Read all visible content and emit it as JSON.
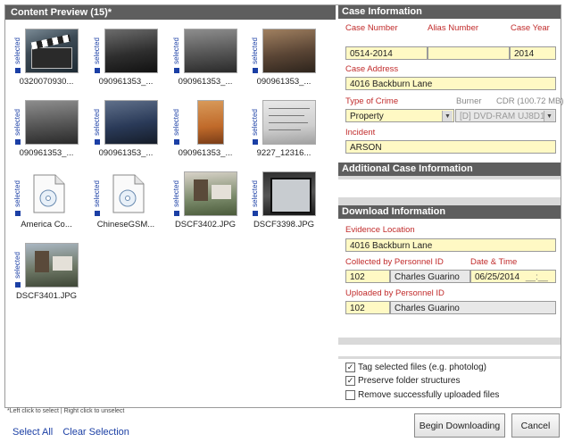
{
  "content_preview": {
    "title": "Content Preview (15)*",
    "selected_label": "selected",
    "items": [
      {
        "caption": "0320070930...",
        "kind": "photo",
        "tone": "clapper"
      },
      {
        "caption": "090961353_...",
        "kind": "photo",
        "tone": "car-dark"
      },
      {
        "caption": "090961353_...",
        "kind": "photo",
        "tone": "car-gray"
      },
      {
        "caption": "090961353_...",
        "kind": "photo",
        "tone": "car-brown"
      },
      {
        "caption": "090961353_...",
        "kind": "photo",
        "tone": "car-gray"
      },
      {
        "caption": "090961353_...",
        "kind": "photo",
        "tone": "car-blue"
      },
      {
        "caption": "090961353_...",
        "kind": "photo",
        "tone": "orange"
      },
      {
        "caption": "9227_12316...",
        "kind": "photo",
        "tone": "paper"
      },
      {
        "caption": "America Co...",
        "kind": "doc",
        "tone": "doc"
      },
      {
        "caption": "ChineseGSM...",
        "kind": "doc",
        "tone": "doc"
      },
      {
        "caption": "DSCF3402.JPG",
        "kind": "photo",
        "tone": "house"
      },
      {
        "caption": "DSCF3398.JPG",
        "kind": "photo",
        "tone": "dark-frame"
      },
      {
        "caption": "DSCF3401.JPG",
        "kind": "photo",
        "tone": "house2"
      }
    ],
    "hint": "*Left click to select | Right click to unselect",
    "select_all": "Select All",
    "clear_selection": "Clear Selection"
  },
  "case_info": {
    "title": "Case Information",
    "case_number_label": "Case Number",
    "alias_number_label": "Alias Number",
    "case_year_label": "Case Year",
    "case_number": "0514-2014",
    "alias_number": "",
    "case_year": "2014",
    "case_address_label": "Case Address",
    "case_address": "4016 Backburn Lane",
    "type_of_crime_label": "Type of Crime",
    "burner_label": "Burner",
    "burner_capacity": "CDR (100.72 MB)",
    "type_of_crime": "Property",
    "burner_value": "[D] DVD-RAM UJ8D1",
    "incident_label": "Incident",
    "incident": "ARSON"
  },
  "additional_info": {
    "title": "Additional Case Information"
  },
  "download_info": {
    "title": "Download Information",
    "evidence_location_label": "Evidence Location",
    "evidence_location": "4016 Backburn Lane",
    "collected_by_label": "Collected by Personnel ID",
    "date_time_label": "Date & Time",
    "collected_id": "102",
    "collected_name": "Charles Guarino",
    "date_value": "06/25/2014",
    "time_value": "__:__",
    "uploaded_by_label": "Uploaded by Personnel ID",
    "uploaded_id": "102",
    "uploaded_name": "Charles Guarino"
  },
  "options": {
    "tag_files": "Tag selected files (e.g. photolog)",
    "preserve_folders": "Preserve folder structures",
    "remove_uploaded": "Remove successfully uploaded files"
  },
  "buttons": {
    "begin": "Begin Downloading",
    "cancel": "Cancel"
  },
  "colors": {
    "header": "#5e5e5e",
    "field": "#fff9c4",
    "label_red": "#c12b2b",
    "link_blue": "#1b3fa5"
  }
}
